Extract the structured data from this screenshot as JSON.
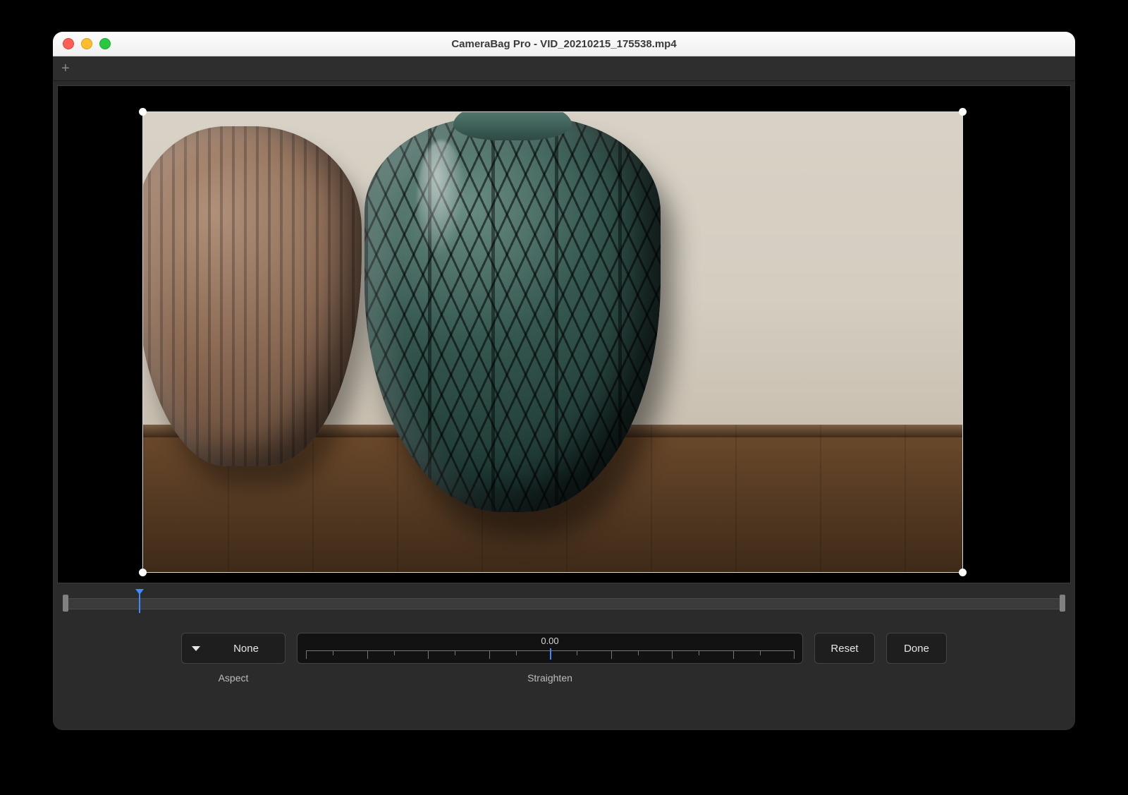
{
  "window": {
    "title": "CameraBag Pro - VID_20210215_175538.mp4"
  },
  "tabbar": {
    "add_tab_tooltip": "New Tab"
  },
  "timeline": {
    "playhead_position_pct": 8
  },
  "controls": {
    "aspect": {
      "selected": "None",
      "label": "Aspect"
    },
    "straighten": {
      "value": "0.00",
      "label": "Straighten",
      "min": -45,
      "max": 45,
      "ticks_major": 9,
      "ticks_minor": 8
    },
    "reset_label": "Reset",
    "done_label": "Done"
  },
  "colors": {
    "accent": "#3d8bff"
  }
}
